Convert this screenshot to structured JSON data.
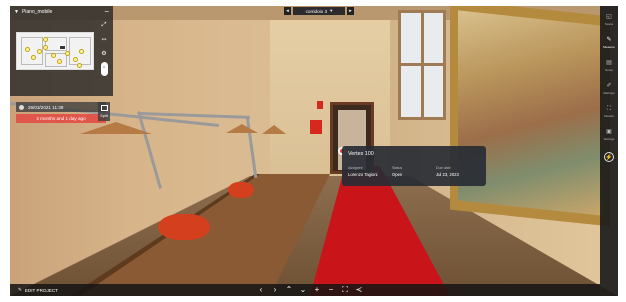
{
  "minimap": {
    "title": "Piano_mobile",
    "caret_icon": "caret-down-icon",
    "minimize_icon": "minus-icon",
    "tools": [
      {
        "name": "expand-icon",
        "glyph": "⤢"
      },
      {
        "name": "fit-width-icon",
        "glyph": "⇿"
      },
      {
        "name": "settings-icon",
        "glyph": "⚙"
      }
    ]
  },
  "timeline": {
    "date_label": "29/03/2021 11:38",
    "age_label": "2 months and 1 day ago"
  },
  "compare": {
    "label": "Split",
    "icon": "split-view-icon"
  },
  "scan_selector": {
    "current": "corridoio 3",
    "prev_icon": "chevron-left-icon",
    "next_icon": "chevron-right-icon"
  },
  "issue": {
    "title": "Vertex 100",
    "fields": [
      {
        "label": "Assignee",
        "value": "Lorenzo Tagioni"
      },
      {
        "label": "Status",
        "value": "Open"
      },
      {
        "label": "Due date",
        "value": "Jul 23, 2023"
      }
    ],
    "status_color": "#e23c3c"
  },
  "sidebar": {
    "items": [
      {
        "label": "Scans",
        "icon": "scans-icon",
        "glyph": "◱",
        "active": false
      },
      {
        "label": "Measure",
        "icon": "ruler-icon",
        "glyph": "✎",
        "active": true
      },
      {
        "label": "Notes",
        "icon": "notes-icon",
        "glyph": "▤",
        "active": false
      },
      {
        "label": "Markups",
        "icon": "pencil-icon",
        "glyph": "✐",
        "active": false
      },
      {
        "label": "Models",
        "icon": "model-icon",
        "glyph": "⛶",
        "active": false
      },
      {
        "label": "Settings",
        "icon": "settings-icon",
        "glyph": "▣",
        "active": false
      }
    ],
    "bottom_icon": "power-icon",
    "bottom_glyph": "⚡"
  },
  "bottom_bar": {
    "edit_label": "EDIT PROJECT",
    "edit_icon": "pencil-icon",
    "controls": [
      {
        "name": "prev-scan-button",
        "glyph": "‹"
      },
      {
        "name": "next-scan-button",
        "glyph": "›"
      },
      {
        "name": "move-up-button",
        "glyph": "⌃"
      },
      {
        "name": "move-down-button",
        "glyph": "⌄"
      },
      {
        "name": "zoom-in-button",
        "glyph": "+"
      },
      {
        "name": "zoom-out-button",
        "glyph": "−"
      },
      {
        "name": "fullscreen-button",
        "glyph": "⛶"
      },
      {
        "name": "share-button",
        "glyph": "≺"
      }
    ]
  },
  "colors": {
    "accent_red": "#e0564a",
    "panel_dark": "#282828"
  }
}
